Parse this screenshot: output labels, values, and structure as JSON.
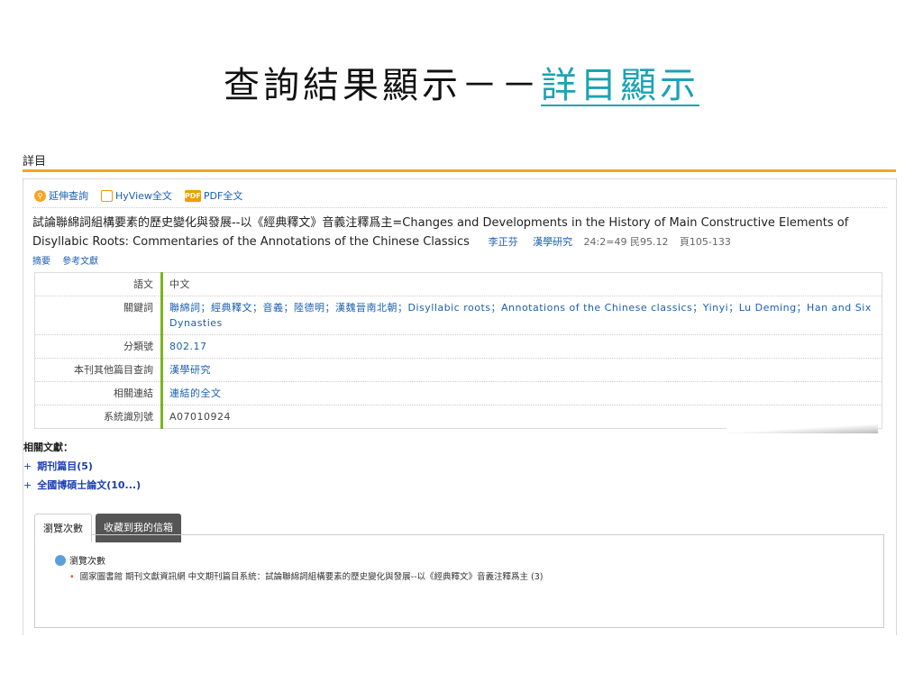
{
  "slide": {
    "title_main": "查詢結果顯示－－",
    "title_link": "詳目顯示"
  },
  "section": {
    "heading": "詳目"
  },
  "toolbar": {
    "extend": "延伸查詢",
    "hyview": "HyView全文",
    "pdf": "PDF全文",
    "pdf_icon_text": "PDF"
  },
  "article": {
    "title": "試論聯綿詞組構要素的歷史變化與發展--以《經典釋文》音義注釋爲主=Changes and Developments in the History of Main Constructive Elements of Disyllabic Roots: Commentaries of the Annotations of the Chinese Classics",
    "author": "李正芬",
    "journal": "漢學研究",
    "volume": "24:2=49 民95.12",
    "pages": "頁105-133"
  },
  "links": {
    "abstract": "摘要",
    "references": "參考文獻"
  },
  "details": {
    "language": {
      "k": "語文",
      "v": "中文"
    },
    "keywords": {
      "k": "關鍵詞",
      "v": "聯綿詞；經典釋文；音義；陸德明；漢魏晉南北朝；Disyllabic roots；Annotations of the Chinese classics；Yinyi；Lu Deming；Han and Six Dynasties"
    },
    "classification": {
      "k": "分類號",
      "v": "802.17"
    },
    "other_issues": {
      "k": "本刊其他篇目查詢",
      "v": "漢學研究"
    },
    "related_link": {
      "k": "相關連結",
      "v": "連結的全文"
    },
    "system_id": {
      "k": "系統識別號",
      "v": "A07010924"
    }
  },
  "related": {
    "heading": "相關文獻：",
    "items": [
      {
        "label": "期刊篇目(5)"
      },
      {
        "label": "全國博碩士論文(10...)"
      }
    ]
  },
  "tabs": {
    "views": "瀏覽次數",
    "mailbox": "收藏到我的信箱"
  },
  "views": {
    "heading": "瀏覽次數",
    "item": "國家圖書館 期刊文獻資訊網 中文期刊篇目系統：試論聯綿詞組構要素的歷史變化與發展--以《經典釋文》音義注釋爲主 (3)"
  }
}
